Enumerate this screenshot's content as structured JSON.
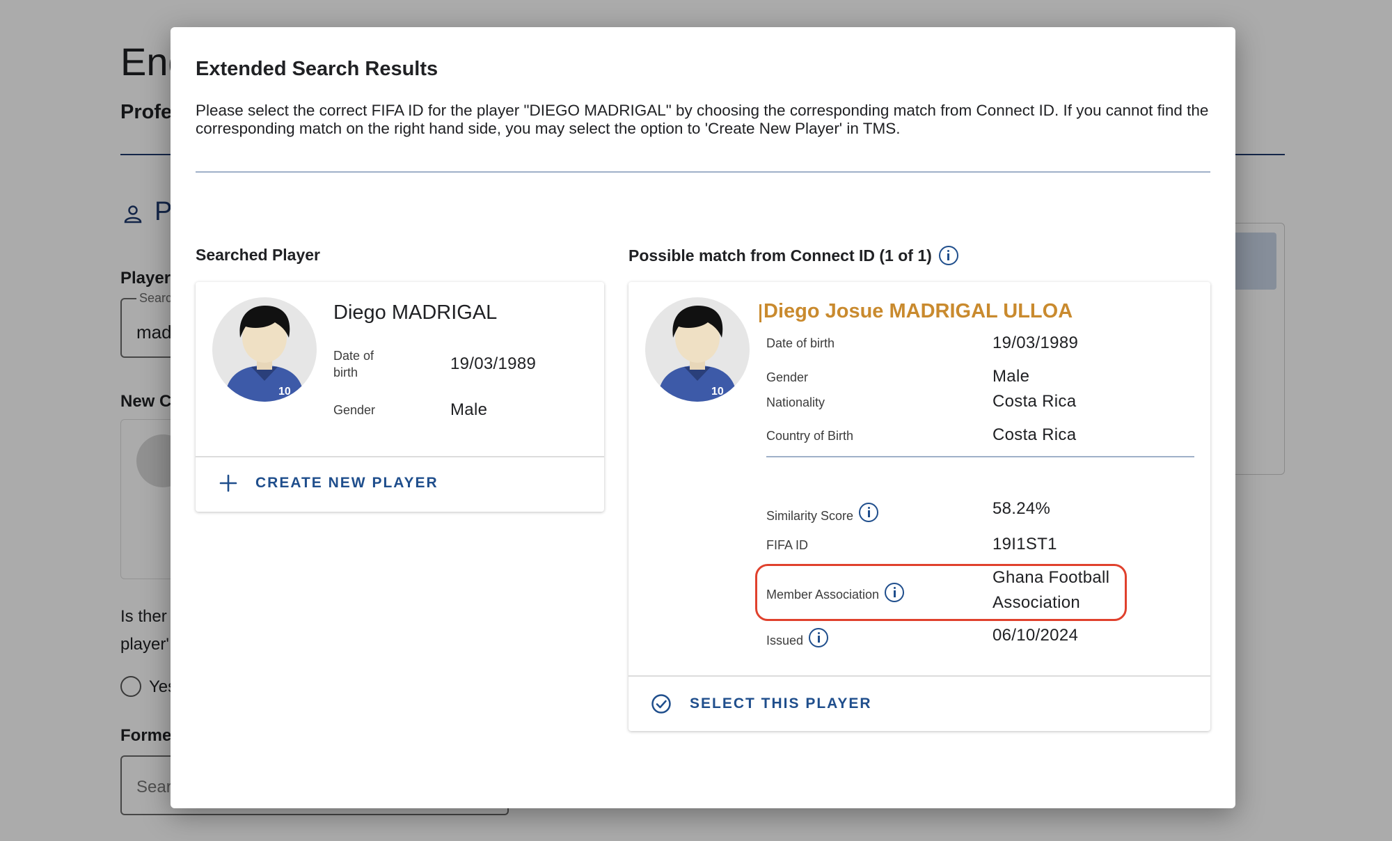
{
  "background": {
    "title": "Eng",
    "subtitle": "Profe",
    "section": "P",
    "player_label": "Player",
    "search_small_label": "Searc",
    "search_value": "mad",
    "new_club_label": "New C",
    "question_line1": "Is ther",
    "question_line2": "player'",
    "radio_yes": "Yes",
    "former_label": "Forme",
    "former_placeholder": "Sear"
  },
  "dialog": {
    "title": "Extended Search Results",
    "description": "Please select the correct FIFA ID for the player \"DIEGO MADRIGAL\" by choosing the corresponding match from Connect ID. If you cannot find the corresponding match on the right hand side, you may select the option to 'Create New Player' in TMS."
  },
  "searched": {
    "heading": "Searched Player",
    "name": "Diego MADRIGAL",
    "dob_label": "Date of birth",
    "dob": "19/03/1989",
    "gender_label": "Gender",
    "gender": "Male",
    "jersey": "10",
    "create_label": "CREATE NEW PLAYER"
  },
  "match": {
    "heading": "Possible match from Connect ID (1 of 1)",
    "name": "Diego Josue MADRIGAL ULLOA",
    "jersey": "10",
    "dob_label": "Date of birth",
    "dob": "19/03/1989",
    "gender_label": "Gender",
    "gender": "Male",
    "nationality_label": "Nationality",
    "nationality": "Costa Rica",
    "cob_label": "Country of Birth",
    "cob": "Costa Rica",
    "similarity_label": "Similarity Score",
    "similarity": "58.24%",
    "fifa_label": "FIFA ID",
    "fifa": "19I1ST1",
    "ma_label": "Member Association",
    "ma_line1": "Ghana Football",
    "ma_line2": "Association",
    "issued_label": "Issued",
    "issued": "06/10/2024",
    "select_label": "SELECT THIS PLAYER"
  },
  "colors": {
    "accent": "#1f4e8c",
    "match_name": "#c98a2e",
    "highlight": "#e0412d"
  }
}
